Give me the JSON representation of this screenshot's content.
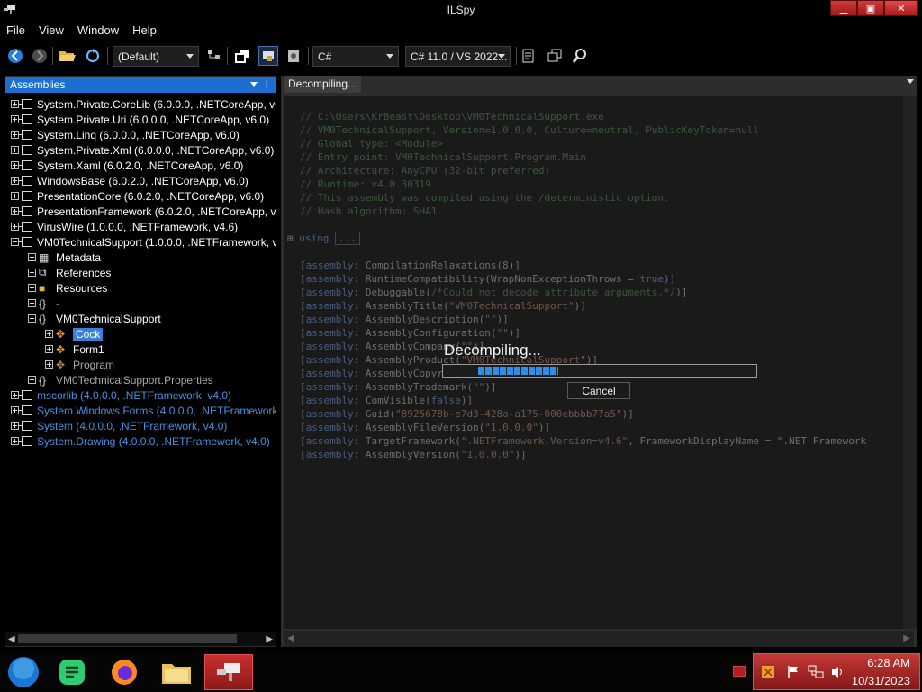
{
  "window": {
    "title": "ILSpy",
    "minimize_glyph": "▁",
    "maximize_glyph": "▣",
    "close_glyph": "✕"
  },
  "menu": [
    "File",
    "View",
    "Window",
    "Help"
  ],
  "toolbar": {
    "filter_combo": "(Default)",
    "language_combo": "C#",
    "version_combo": "C# 11.0 / VS 2022..."
  },
  "assemblies_panel": {
    "title": "Assemblies",
    "pin_glyph": "⊥",
    "items": [
      {
        "label": "System.Private.CoreLib (6.0.0.0, .NETCoreApp, v6",
        "style": "normal"
      },
      {
        "label": "System.Private.Uri (6.0.0.0, .NETCoreApp, v6.0)",
        "style": "normal"
      },
      {
        "label": "System.Linq (6.0.0.0, .NETCoreApp, v6.0)",
        "style": "normal"
      },
      {
        "label": "System.Private.Xml (6.0.0.0, .NETCoreApp, v6.0)",
        "style": "normal"
      },
      {
        "label": "System.Xaml (6.0.2.0, .NETCoreApp, v6.0)",
        "style": "normal"
      },
      {
        "label": "WindowsBase (6.0.2.0, .NETCoreApp, v6.0)",
        "style": "normal"
      },
      {
        "label": "PresentationCore (6.0.2.0, .NETCoreApp, v6.0)",
        "style": "normal"
      },
      {
        "label": "PresentationFramework (6.0.2.0, .NETCoreApp, v",
        "style": "normal"
      },
      {
        "label": "VirusWire (1.0.0.0, .NETFramework, v4.6)",
        "style": "normal"
      },
      {
        "label": "VM0TechnicalSupport (1.0.0.0, .NETFramework, v",
        "style": "normal"
      },
      {
        "label": "Metadata",
        "style": "normal"
      },
      {
        "label": "References",
        "style": "normal"
      },
      {
        "label": "Resources",
        "style": "normal"
      },
      {
        "label": "-",
        "style": "normal"
      },
      {
        "label": "VM0TechnicalSupport",
        "style": "normal"
      },
      {
        "label": "Cock",
        "style": "selected"
      },
      {
        "label": "Form1",
        "style": "normal"
      },
      {
        "label": "Program",
        "style": "grey"
      },
      {
        "label": "VM0TechnicalSupport.Properties",
        "style": "grey"
      },
      {
        "label": "mscorlib (4.0.0.0, .NETFramework, v4.0)",
        "style": "blue"
      },
      {
        "label": "System.Windows.Forms (4.0.0.0, .NETFramework",
        "style": "blue"
      },
      {
        "label": "System (4.0.0.0, .NETFramework, v4.0)",
        "style": "blue"
      },
      {
        "label": "System.Drawing (4.0.0.0, .NETFramework, v4.0)",
        "style": "blue"
      }
    ]
  },
  "editor": {
    "tab_label": "Decompiling...",
    "header_lines": [
      "// C:\\Users\\KrBeast\\Desktop\\VM0TechnicalSupport.exe",
      "// VM0TechnicalSupport, Version=1.0.0.0, Culture=neutral, PublicKeyToken=null",
      "// Global type: <Module>",
      "// Entry point: VM0TechnicalSupport.Program.Main",
      "// Architecture: AnyCPU (32-bit preferred)",
      "// Runtime: v4.0.30319",
      "// This assembly was compiled using the /deterministic option.",
      "// Hash algorithm: SHA1"
    ],
    "using_keyword": "using",
    "using_collapsed": "...",
    "attribute_lines": [
      {
        "prefix": "[",
        "kw": "assembly",
        "rest": ": CompilationRelaxations(8)]"
      },
      {
        "prefix": "[",
        "kw": "assembly",
        "rest": ": RuntimeCompatibility(WrapNonExceptionThrows = true)]"
      },
      {
        "prefix": "[",
        "kw": "assembly",
        "rest": ": Debuggable(/*Could not decode attribute arguments.*/)]"
      },
      {
        "prefix": "[",
        "kw": "assembly",
        "rest": ": AssemblyTitle(\"VM0TechnicalSupport\")]"
      },
      {
        "prefix": "[",
        "kw": "assembly",
        "rest": ": AssemblyDescription(\"\")]"
      },
      {
        "prefix": "[",
        "kw": "assembly",
        "rest": ": AssemblyConfiguration(\"\")]"
      },
      {
        "prefix": "[",
        "kw": "assembly",
        "rest": ": AssemblyCompany(\"\")]"
      },
      {
        "prefix": "[",
        "kw": "assembly",
        "rest": ": AssemblyProduct(\"VM0TechnicalSupport\")]"
      },
      {
        "prefix": "[",
        "kw": "assembly",
        "rest": ": AssemblyCopyright(\"Copyright © 2023\")]"
      },
      {
        "prefix": "[",
        "kw": "assembly",
        "rest": ": AssemblyTrademark(\"\")]"
      },
      {
        "prefix": "[",
        "kw": "assembly",
        "rest": ": ComVisible(false)]"
      },
      {
        "prefix": "[",
        "kw": "assembly",
        "rest": ": Guid(\"8925678b-e7d3-428a-a175-000ebbbb77a5\")]"
      },
      {
        "prefix": "[",
        "kw": "assembly",
        "rest": ": AssemblyFileVersion(\"1.0.0.0\")]"
      },
      {
        "prefix": "[",
        "kw": "assembly",
        "rest": ": TargetFramework(\".NETFramework,Version=v4.6\", FrameworkDisplayName = \".NET Framework"
      },
      {
        "prefix": "[",
        "kw": "assembly",
        "rest": ": AssemblyVersion(\"1.0.0.0\")]"
      }
    ]
  },
  "decompile_dialog": {
    "message": "Decompiling...",
    "progress": 0.33,
    "cancel_label": "Cancel"
  },
  "taskbar": {
    "time": "6:28 AM",
    "date": "10/31/2023"
  }
}
